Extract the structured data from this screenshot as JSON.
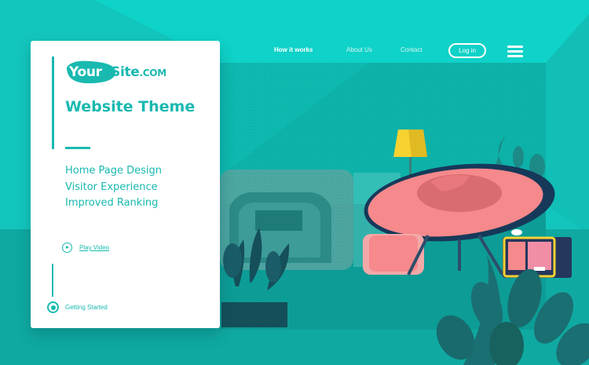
{
  "brand": {
    "logo_your": "Your",
    "logo_site": "Site",
    "logo_tld": ".COM"
  },
  "hero": {
    "title": "Website Theme",
    "features": [
      "Home Page Design",
      "Visitor Experience",
      "Improved Ranking"
    ],
    "play_video_label": "Play Video",
    "getting_started_label": "Getting Started"
  },
  "nav": {
    "items": [
      "How it works",
      "About Us",
      "Contact"
    ],
    "login_label": "Log in"
  },
  "colors": {
    "accent": "#19b9b0",
    "background": "#11c4bb",
    "chair": "#f5898b",
    "lamp": "#f7d332"
  },
  "icons": [
    "play-icon",
    "hamburger-menu-icon",
    "step-dot-icon"
  ]
}
